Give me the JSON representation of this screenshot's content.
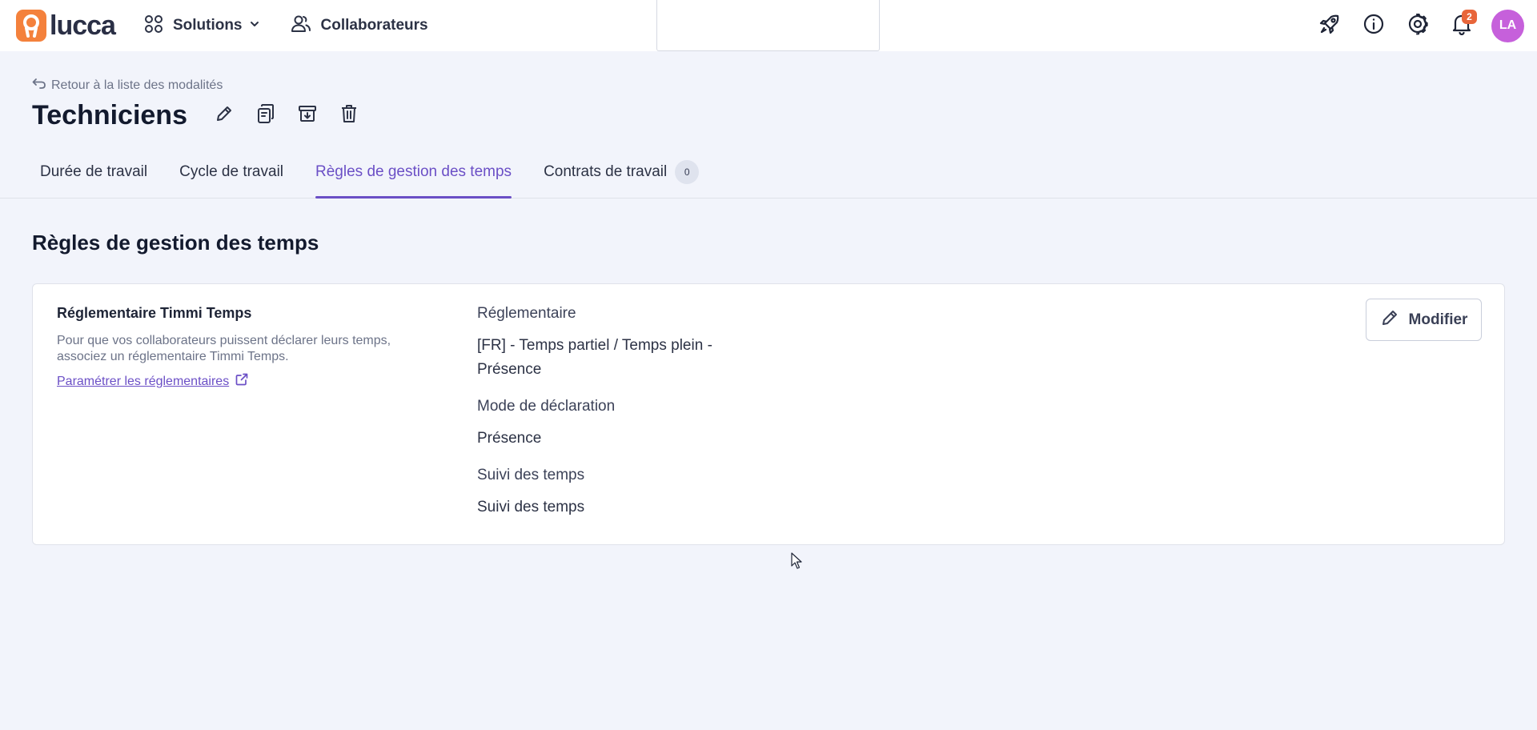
{
  "topbar": {
    "brand_name": "lucca",
    "solutions_label": "Solutions",
    "collaborators_label": "Collaborateurs",
    "notifications_count": "2",
    "avatar_initials": "LA"
  },
  "header": {
    "back_label": "Retour à la liste des modalités",
    "title": "Techniciens",
    "tabs": [
      {
        "label": "Durée de travail"
      },
      {
        "label": "Cycle de travail"
      },
      {
        "label": "Règles de gestion des temps"
      },
      {
        "label": "Contrats de travail",
        "count": "0"
      }
    ],
    "active_tab_index": 2
  },
  "section": {
    "title": "Règles de gestion des temps",
    "card": {
      "left_title": "Réglementaire Timmi Temps",
      "left_description": "Pour que vos collaborateurs puissent déclarer leurs temps, associez un réglementaire Timmi Temps.",
      "left_link": "Paramétrer les réglementaires",
      "fields": [
        {
          "label": "Réglementaire",
          "value": "[FR] - Temps partiel / Temps plein - Présence"
        },
        {
          "label": "Mode de déclaration",
          "value": "Présence"
        },
        {
          "label": "Suivi des temps",
          "value": "Suivi des temps"
        }
      ],
      "modify_label": "Modifier"
    }
  },
  "colors": {
    "accent": "#6b4fc6",
    "brand_orange": "#f4813c",
    "avatar": "#c660db",
    "notification": "#e8653a",
    "background": "#f2f4fb"
  }
}
